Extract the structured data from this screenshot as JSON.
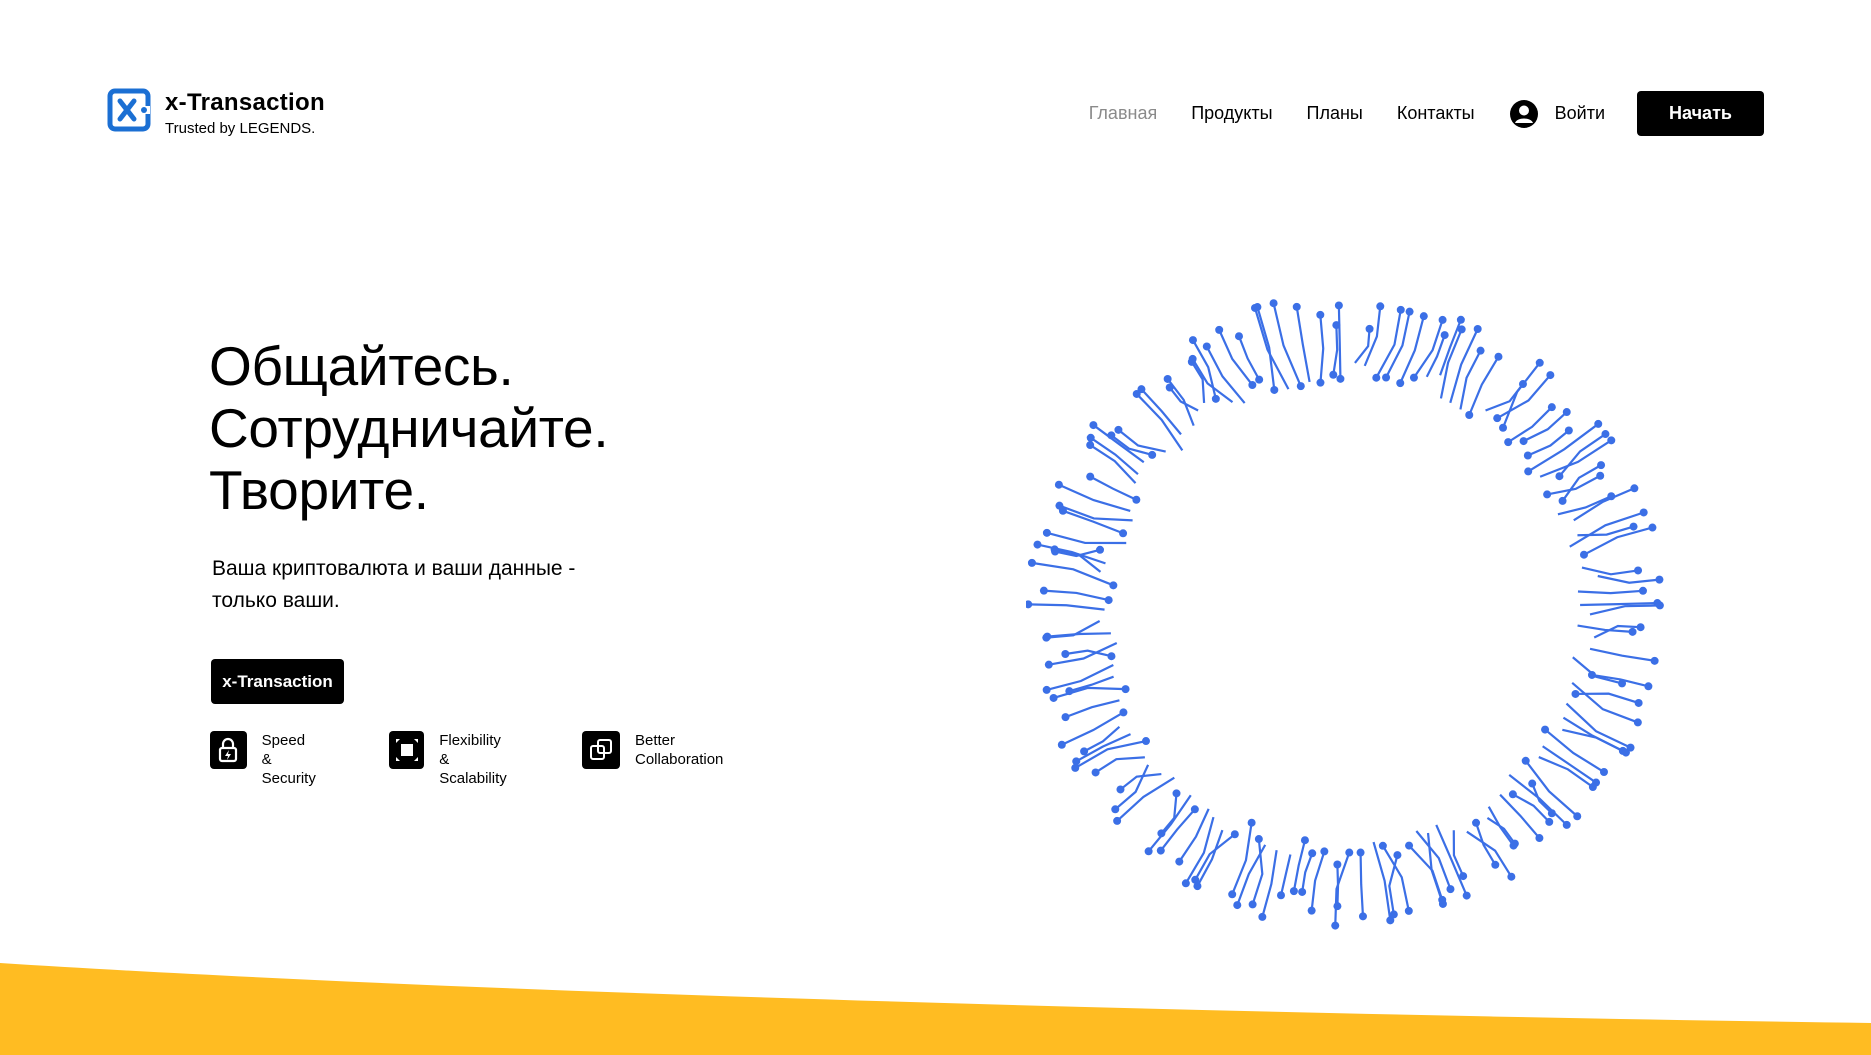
{
  "brand": {
    "name": "x-Transaction",
    "tagline": "Trusted by LEGENDS.",
    "logo_icon": "x-logo-icon",
    "accent_color": "#1b6fd3"
  },
  "nav": {
    "items": [
      {
        "label": "Главная",
        "active": true
      },
      {
        "label": "Продукты",
        "active": false
      },
      {
        "label": "Планы",
        "active": false
      },
      {
        "label": "Контакты",
        "active": false
      }
    ],
    "login_label": "Войти",
    "login_icon": "user-icon",
    "start_label": "Начать"
  },
  "hero": {
    "title_lines": [
      "Общайтесь.",
      "Сотрудничайте.",
      "Творите."
    ],
    "subtitle_line1": "Ваша криптовалюта и ваши данные -",
    "subtitle_line2": "только ваши.",
    "cta_label": "x-Transaction"
  },
  "features": [
    {
      "icon": "lock-bolt-icon",
      "line1": "Speed &",
      "line2": "Security"
    },
    {
      "icon": "expand-icon",
      "line1": "Flexibility &",
      "line2": "Scalability"
    },
    {
      "icon": "overlap-squares-icon",
      "line1": "Better",
      "line2": "Collaboration"
    }
  ],
  "decor": {
    "ring_icon": "circuit-ring-graphic",
    "ring_color": "#3b6fe6",
    "wave_color": "#ffbc22"
  }
}
